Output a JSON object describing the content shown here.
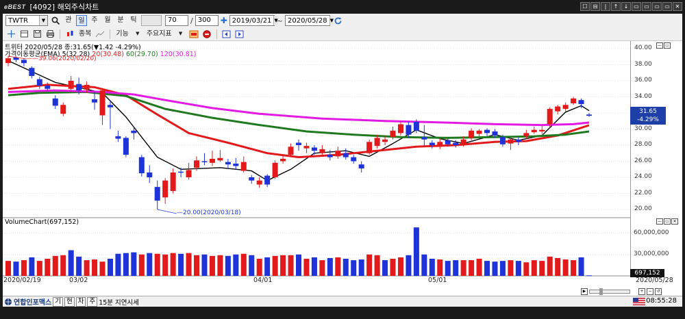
{
  "window": {
    "logo": "eBEST",
    "title": "[4092] 해외주식차트",
    "controls": [
      "☐",
      "⊟",
      "|",
      "↑",
      "↓",
      "▭",
      "▭",
      "▭",
      "▭",
      "✕"
    ]
  },
  "toolbar": {
    "ticker": "TWTR",
    "periods": [
      "일",
      "주",
      "월",
      "분",
      "틱"
    ],
    "period_active": "일",
    "search_label": "관",
    "count_value": "70",
    "total_value": "300",
    "start_date": "2019/03/21",
    "end_date": "2020/05/28",
    "date_separator": "~"
  },
  "toolbar2": {
    "mode_label": "종복",
    "function_label": "기능",
    "indicator_label": "주요지표"
  },
  "chart": {
    "header": "트위터  2020/05/28 종:31.65(▼1.42  -4.29%)",
    "ema_label": "가격이동평균(EMA)",
    "ema_values": [
      {
        "label": "5(32.28)",
        "color": "#000000"
      },
      {
        "label": "20(30.48)",
        "color": "#e31a1c"
      },
      {
        "label": "60(29.70)",
        "color": "#1f7a1f"
      },
      {
        "label": "120(30.81)",
        "color": "#e31ae3"
      }
    ],
    "high_annotation": "39.06(2020/02/20)",
    "low_annotation": "20.00(2020/03/18)",
    "price_tag_price": "31.65",
    "price_tag_change": "-4.29%",
    "volume_header": "VolumeChart(697,152)",
    "volume_tag": "697,152",
    "date_labels": [
      "2020/02/19",
      "03/02",
      "04/01",
      "05/01",
      "2020/05/28"
    ]
  },
  "chart_data": [
    {
      "type": "candlestick",
      "title": "",
      "ylim": [
        19,
        41
      ],
      "y_ticks": [
        20,
        22,
        24,
        26,
        28,
        30,
        32,
        34,
        36,
        38,
        40
      ],
      "y_tick_labels": [
        "20.00",
        "22.00",
        "24.00",
        "26.00",
        "28.00",
        "30.00",
        "32.00",
        "34.00",
        "36.00",
        "38.00",
        "40.00"
      ],
      "colors": {
        "up": "#e31a1c",
        "down": "#1f34d8"
      },
      "candles": [
        {
          "o": 38.2,
          "c": 38.8,
          "h": 39.06,
          "l": 37.8
        },
        {
          "o": 38.9,
          "c": 38.6,
          "h": 39.0,
          "l": 38.3
        },
        {
          "o": 38.6,
          "c": 38.2,
          "h": 38.8,
          "l": 37.8
        },
        {
          "o": 37.6,
          "c": 36.6,
          "h": 37.8,
          "l": 36.3
        },
        {
          "o": 36.2,
          "c": 35.4,
          "h": 36.5,
          "l": 35.0
        },
        {
          "o": 35.4,
          "c": 35.0,
          "h": 35.8,
          "l": 34.8
        },
        {
          "o": 33.8,
          "c": 32.9,
          "h": 34.2,
          "l": 32.5
        },
        {
          "o": 31.9,
          "c": 33.0,
          "h": 33.3,
          "l": 31.6
        },
        {
          "o": 35.0,
          "c": 36.0,
          "h": 36.6,
          "l": 34.6
        },
        {
          "o": 35.6,
          "c": 34.8,
          "h": 36.4,
          "l": 34.3
        },
        {
          "o": 34.9,
          "c": 35.5,
          "h": 35.9,
          "l": 34.5
        },
        {
          "o": 33.7,
          "c": 33.3,
          "h": 34.6,
          "l": 32.4
        },
        {
          "o": 31.7,
          "c": 34.8,
          "h": 35.1,
          "l": 30.5
        },
        {
          "o": 33.0,
          "c": 32.7,
          "h": 33.6,
          "l": 30.0
        },
        {
          "o": 29.1,
          "c": 28.8,
          "h": 29.8,
          "l": 28.4
        },
        {
          "o": 28.9,
          "c": 26.8,
          "h": 29.1,
          "l": 26.5
        },
        {
          "o": 29.8,
          "c": 29.5,
          "h": 30.3,
          "l": 28.7
        },
        {
          "o": 26.5,
          "c": 24.5,
          "h": 26.8,
          "l": 24.1
        },
        {
          "o": 24.6,
          "c": 24.0,
          "h": 25.5,
          "l": 23.3
        },
        {
          "o": 22.8,
          "c": 21.1,
          "h": 23.6,
          "l": 20.0
        },
        {
          "o": 21.5,
          "c": 23.6,
          "h": 23.9,
          "l": 20.7
        },
        {
          "o": 22.3,
          "c": 24.6,
          "h": 25.1,
          "l": 22.0
        },
        {
          "o": 24.7,
          "c": 24.6,
          "h": 25.2,
          "l": 24.0
        },
        {
          "o": 24.0,
          "c": 24.9,
          "h": 25.8,
          "l": 23.7
        },
        {
          "o": 25.2,
          "c": 26.1,
          "h": 26.6,
          "l": 24.8
        },
        {
          "o": 26.0,
          "c": 25.9,
          "h": 27.0,
          "l": 25.5
        },
        {
          "o": 25.8,
          "c": 26.3,
          "h": 27.3,
          "l": 25.4
        },
        {
          "o": 26.1,
          "c": 26.4,
          "h": 27.4,
          "l": 25.9
        },
        {
          "o": 25.9,
          "c": 25.6,
          "h": 26.3,
          "l": 25.1
        },
        {
          "o": 25.7,
          "c": 25.4,
          "h": 26.4,
          "l": 25.0
        },
        {
          "o": 24.8,
          "c": 25.9,
          "h": 26.6,
          "l": 24.6
        },
        {
          "o": 24.0,
          "c": 23.6,
          "h": 24.3,
          "l": 23.2
        },
        {
          "o": 23.1,
          "c": 23.6,
          "h": 24.0,
          "l": 22.7
        },
        {
          "o": 24.2,
          "c": 23.1,
          "h": 24.4,
          "l": 22.8
        },
        {
          "o": 24.0,
          "c": 25.8,
          "h": 26.1,
          "l": 23.8
        },
        {
          "o": 26.0,
          "c": 26.3,
          "h": 26.8,
          "l": 25.7
        },
        {
          "o": 26.8,
          "c": 27.8,
          "h": 28.2,
          "l": 26.5
        },
        {
          "o": 28.3,
          "c": 28.0,
          "h": 28.7,
          "l": 27.3
        },
        {
          "o": 27.6,
          "c": 27.9,
          "h": 28.3,
          "l": 27.0
        },
        {
          "o": 27.7,
          "c": 27.3,
          "h": 28.0,
          "l": 26.8
        },
        {
          "o": 27.0,
          "c": 27.5,
          "h": 28.0,
          "l": 26.6
        },
        {
          "o": 26.8,
          "c": 26.5,
          "h": 27.4,
          "l": 26.1
        },
        {
          "o": 26.6,
          "c": 27.3,
          "h": 27.8,
          "l": 26.3
        },
        {
          "o": 27.0,
          "c": 26.5,
          "h": 27.6,
          "l": 26.2
        },
        {
          "o": 26.5,
          "c": 26.0,
          "h": 26.8,
          "l": 25.7
        },
        {
          "o": 25.6,
          "c": 25.1,
          "h": 26.0,
          "l": 24.6
        },
        {
          "o": 27.0,
          "c": 28.4,
          "h": 28.7,
          "l": 26.8
        },
        {
          "o": 27.9,
          "c": 28.9,
          "h": 29.3,
          "l": 27.6
        },
        {
          "o": 28.4,
          "c": 28.7,
          "h": 29.1,
          "l": 28.0
        },
        {
          "o": 29.0,
          "c": 29.8,
          "h": 30.3,
          "l": 28.7
        },
        {
          "o": 29.5,
          "c": 30.6,
          "h": 30.9,
          "l": 29.2
        },
        {
          "o": 30.5,
          "c": 29.3,
          "h": 30.9,
          "l": 28.9
        },
        {
          "o": 30.9,
          "c": 29.8,
          "h": 31.2,
          "l": 29.5
        },
        {
          "o": 29.0,
          "c": 28.7,
          "h": 30.5,
          "l": 27.9
        },
        {
          "o": 28.3,
          "c": 28.0,
          "h": 28.6,
          "l": 27.6
        },
        {
          "o": 27.8,
          "c": 28.4,
          "h": 28.8,
          "l": 27.5
        },
        {
          "o": 28.6,
          "c": 28.1,
          "h": 28.9,
          "l": 27.8
        },
        {
          "o": 28.3,
          "c": 28.0,
          "h": 28.6,
          "l": 27.7
        },
        {
          "o": 28.0,
          "c": 28.7,
          "h": 29.1,
          "l": 27.8
        },
        {
          "o": 28.9,
          "c": 29.8,
          "h": 30.1,
          "l": 28.6
        },
        {
          "o": 29.4,
          "c": 29.8,
          "h": 30.0,
          "l": 29.0
        },
        {
          "o": 29.9,
          "c": 29.5,
          "h": 30.1,
          "l": 29.1
        },
        {
          "o": 29.7,
          "c": 29.2,
          "h": 30.0,
          "l": 28.9
        },
        {
          "o": 29.0,
          "c": 28.1,
          "h": 29.3,
          "l": 27.8
        },
        {
          "o": 28.2,
          "c": 28.7,
          "h": 28.9,
          "l": 27.4
        },
        {
          "o": 28.7,
          "c": 28.4,
          "h": 29.0,
          "l": 28.0
        },
        {
          "o": 29.1,
          "c": 29.5,
          "h": 29.9,
          "l": 28.8
        },
        {
          "o": 29.6,
          "c": 29.9,
          "h": 30.3,
          "l": 29.4
        },
        {
          "o": 29.7,
          "c": 29.9,
          "h": 30.4,
          "l": 29.4
        },
        {
          "o": 30.6,
          "c": 32.5,
          "h": 32.7,
          "l": 30.3
        },
        {
          "o": 32.2,
          "c": 32.8,
          "h": 33.0,
          "l": 31.8
        },
        {
          "o": 32.5,
          "c": 33.0,
          "h": 33.3,
          "l": 32.2
        },
        {
          "o": 33.2,
          "c": 33.8,
          "h": 34.0,
          "l": 33.0
        },
        {
          "o": 33.6,
          "c": 33.1,
          "h": 33.8,
          "l": 32.6
        },
        {
          "o": 31.8,
          "c": 31.65,
          "h": 32.0,
          "l": 31.5
        }
      ],
      "ema": [
        {
          "name": "5",
          "color": "#000000",
          "points": [
            [
              0,
              38.5
            ],
            [
              6,
              35.8
            ],
            [
              12,
              34.5
            ],
            [
              15,
              31.5
            ],
            [
              19,
              26.5
            ],
            [
              22,
              25.0
            ],
            [
              27,
              25.2
            ],
            [
              31,
              24.8
            ],
            [
              33,
              23.6
            ],
            [
              36,
              25.0
            ],
            [
              39,
              27.0
            ],
            [
              43,
              27.3
            ],
            [
              46,
              26.6
            ],
            [
              49,
              28.2
            ],
            [
              52,
              29.9
            ],
            [
              55,
              28.8
            ],
            [
              58,
              28.2
            ],
            [
              62,
              29.3
            ],
            [
              65,
              28.6
            ],
            [
              68,
              29.2
            ],
            [
              71,
              32.1
            ],
            [
              73,
              32.9
            ],
            [
              74,
              32.28
            ]
          ]
        },
        {
          "name": "20",
          "color": "#e31a1c",
          "points": [
            [
              0,
              35.0
            ],
            [
              5,
              35.5
            ],
            [
              11,
              35.2
            ],
            [
              15,
              34.2
            ],
            [
              19,
              31.8
            ],
            [
              23,
              29.5
            ],
            [
              28,
              28.3
            ],
            [
              33,
              27.0
            ],
            [
              37,
              26.5
            ],
            [
              42,
              26.8
            ],
            [
              47,
              27.3
            ],
            [
              52,
              27.8
            ],
            [
              57,
              28.0
            ],
            [
              62,
              28.4
            ],
            [
              66,
              28.5
            ],
            [
              70,
              29.2
            ],
            [
              74,
              30.48
            ]
          ]
        },
        {
          "name": "60",
          "color": "#1f7a1f",
          "points": [
            [
              0,
              34.2
            ],
            [
              4,
              34.5
            ],
            [
              10,
              34.6
            ],
            [
              15,
              34.1
            ],
            [
              20,
              32.5
            ],
            [
              26,
              31.4
            ],
            [
              32,
              30.5
            ],
            [
              38,
              29.7
            ],
            [
              44,
              29.3
            ],
            [
              50,
              29.0
            ],
            [
              56,
              28.9
            ],
            [
              62,
              29.0
            ],
            [
              67,
              29.1
            ],
            [
              71,
              29.3
            ],
            [
              74,
              29.7
            ]
          ]
        },
        {
          "name": "120",
          "color": "#e31ae3",
          "points": [
            [
              0,
              34.6
            ],
            [
              6,
              34.8
            ],
            [
              12,
              34.6
            ],
            [
              16,
              34.3
            ],
            [
              20,
              33.6
            ],
            [
              26,
              32.6
            ],
            [
              32,
              31.9
            ],
            [
              40,
              31.3
            ],
            [
              48,
              31.0
            ],
            [
              56,
              30.8
            ],
            [
              62,
              30.6
            ],
            [
              68,
              30.5
            ],
            [
              72,
              30.6
            ],
            [
              74,
              30.81
            ]
          ]
        }
      ]
    },
    {
      "type": "bar",
      "title": "",
      "ylim": [
        0,
        72000000
      ],
      "y_ticks": [
        30000000,
        60000000
      ],
      "y_tick_labels": [
        "30,000,000",
        "60,000,000"
      ],
      "colors": {
        "up": "#e31a1c",
        "down": "#1f34d8"
      },
      "values": [
        21000000,
        20000000,
        22000000,
        26000000,
        21000000,
        24000000,
        28000000,
        29000000,
        36000000,
        27000000,
        22000000,
        23000000,
        20000000,
        24000000,
        31000000,
        32000000,
        33000000,
        30000000,
        32000000,
        31000000,
        30000000,
        32000000,
        31000000,
        32000000,
        29000000,
        30000000,
        28000000,
        29000000,
        28000000,
        30000000,
        31000000,
        29000000,
        24000000,
        26000000,
        28000000,
        29000000,
        29000000,
        30000000,
        24000000,
        26000000,
        22000000,
        25000000,
        26000000,
        24000000,
        22000000,
        23000000,
        30000000,
        29000000,
        22000000,
        24000000,
        26000000,
        29000000,
        68000000,
        30000000,
        24000000,
        23000000,
        21000000,
        22000000,
        22000000,
        22000000,
        24000000,
        21000000,
        20000000,
        21000000,
        22000000,
        21000000,
        19000000,
        22000000,
        21000000,
        27000000,
        25000000,
        23000000,
        22000000,
        26000000,
        697152
      ],
      "up": [
        1,
        0,
        1,
        0,
        1,
        1,
        1,
        1,
        0,
        0,
        1,
        1,
        1,
        0,
        0,
        0,
        0,
        1,
        0,
        1,
        1,
        1,
        0,
        1,
        1,
        0,
        1,
        1,
        0,
        0,
        1,
        0,
        1,
        0,
        1,
        1,
        1,
        0,
        1,
        0,
        1,
        0,
        1,
        0,
        0,
        0,
        1,
        1,
        0,
        1,
        1,
        0,
        0,
        0,
        0,
        1,
        0,
        0,
        1,
        1,
        1,
        0,
        0,
        0,
        1,
        0,
        1,
        1,
        1,
        1,
        1,
        1,
        1,
        0,
        0
      ]
    }
  ],
  "statusbar": {
    "news_logo": "연합인포맥스",
    "buttons": [
      "기",
      "현",
      "차",
      "주"
    ],
    "delay_text": "15분 지연시세",
    "clock": "08:55:28"
  }
}
